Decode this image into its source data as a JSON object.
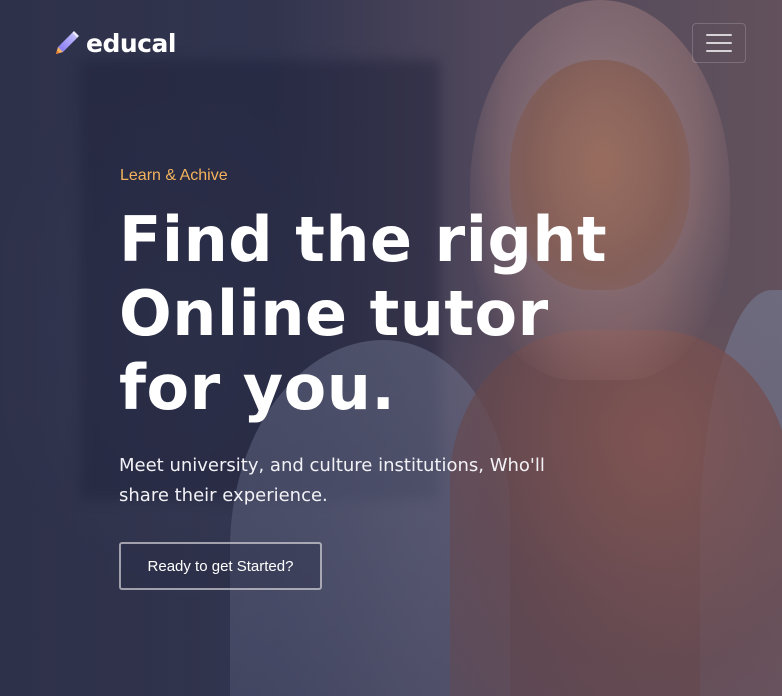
{
  "brand": {
    "name": "educal",
    "icon": "pencil-icon"
  },
  "nav": {
    "menu_icon": "hamburger-menu-icon"
  },
  "hero": {
    "eyebrow": "Learn & Achive",
    "headline_lines": [
      "Find the right",
      "Online tutor",
      "for you."
    ],
    "subtitle": "Meet university, and culture institutions, Who'll share their experience.",
    "cta_label": "Ready to get Started?"
  },
  "colors": {
    "accent": "#f3b35c",
    "text": "#ffffff",
    "overlay": "#2b2f43"
  }
}
